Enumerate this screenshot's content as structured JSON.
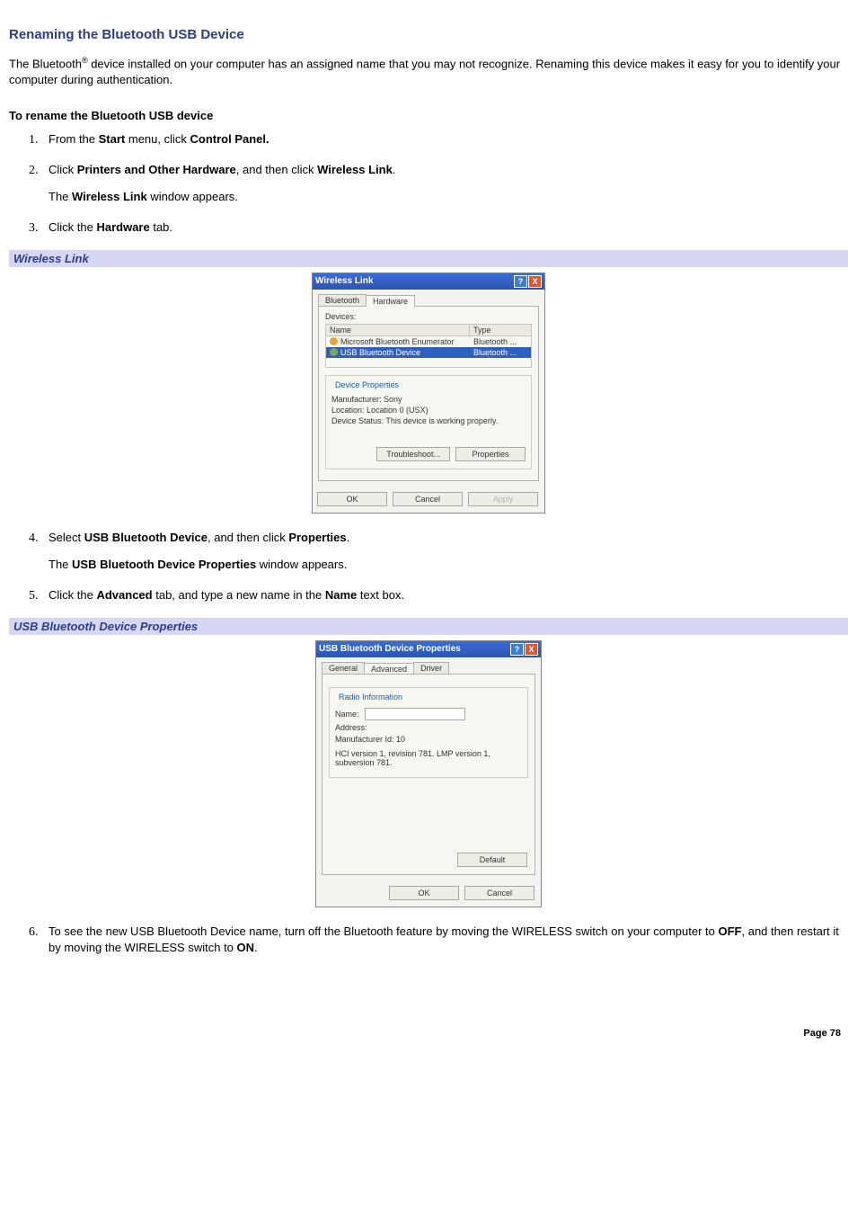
{
  "heading": "Renaming the Bluetooth USB Device",
  "intro_pre": "The Bluetooth",
  "intro_reg": "®",
  "intro_post": " device installed on your computer has an assigned name that you may not recognize. Renaming this device makes it easy for you to identify your computer during authentication.",
  "subhead": "To rename the Bluetooth USB device",
  "steps": {
    "s1a": "From the ",
    "s1b": "Start",
    "s1c": " menu, click ",
    "s1d": "Control Panel.",
    "s2a": "Click ",
    "s2b": "Printers and Other Hardware",
    "s2c": ", and then click ",
    "s2d": "Wireless Link",
    "s2e": ".",
    "s2f": "The ",
    "s2g": "Wireless Link",
    "s2h": " window appears.",
    "s3a": "Click the ",
    "s3b": "Hardware",
    "s3c": " tab.",
    "s4a": "Select ",
    "s4b": "USB Bluetooth Device",
    "s4c": ", and then click ",
    "s4d": "Properties",
    "s4e": ".",
    "s4f": "The ",
    "s4g": "USB Bluetooth Device Properties",
    "s4h": " window appears.",
    "s5a": "Click the ",
    "s5b": "Advanced",
    "s5c": " tab, and type a new name in the ",
    "s5d": "Name",
    "s5e": " text box.",
    "s6a": "To see the new USB Bluetooth Device name, turn off the Bluetooth feature by moving the WIRELESS switch on your computer to ",
    "s6b": "OFF",
    "s6c": ", and then restart it by moving the WIRELESS switch to ",
    "s6d": "ON",
    "s6e": "."
  },
  "caption1": "Wireless Link",
  "caption2": "USB Bluetooth Device Properties",
  "dlg1": {
    "title": "Wireless Link",
    "help": "?",
    "close": "X",
    "tabs": {
      "bluetooth": "Bluetooth",
      "hardware": "Hardware"
    },
    "devices_label": "Devices:",
    "col_name": "Name",
    "col_type": "Type",
    "row1_name": "Microsoft Bluetooth Enumerator",
    "row1_type": "Bluetooth ...",
    "row2_name": "USB Bluetooth Device",
    "row2_type": "Bluetooth ...",
    "devprops_title": "Device Properties",
    "manuf": "Manufacturer: Sony",
    "loc": "Location: Location 0 (USX)",
    "status": "Device Status: This device is working properly.",
    "troubleshoot": "Troubleshoot...",
    "properties": "Properties",
    "ok": "OK",
    "cancel": "Cancel",
    "apply": "Apply"
  },
  "dlg2": {
    "title": "USB Bluetooth Device Properties",
    "help": "?",
    "close": "X",
    "tabs": {
      "general": "General",
      "advanced": "Advanced",
      "driver": "Driver"
    },
    "group_title": "Radio Information",
    "name_label": "Name:",
    "addr_label": "Address:",
    "manuf_label": "Manufacturer Id:    10",
    "versions": "HCI version 1, revision 781.  LMP version 1, subversion 781.",
    "default": "Default",
    "ok": "OK",
    "cancel": "Cancel"
  },
  "page_num": "Page 78"
}
